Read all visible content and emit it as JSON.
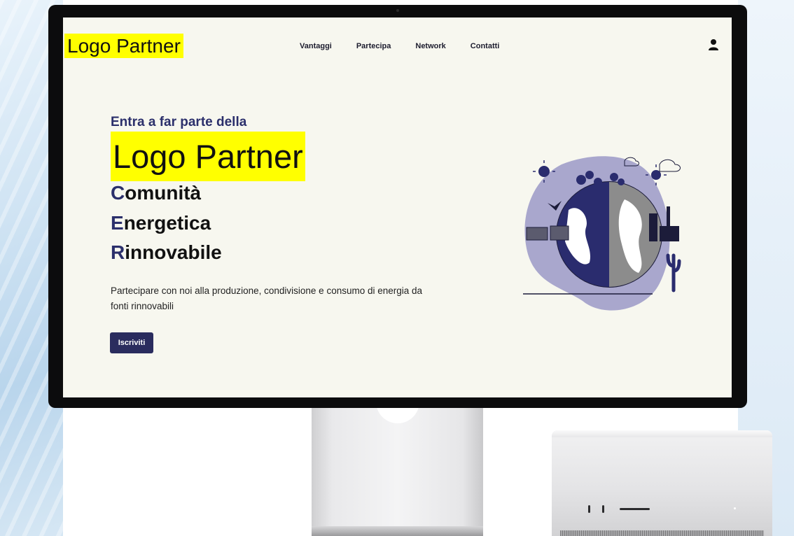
{
  "nav": {
    "logo": "Logo Partner",
    "items": [
      {
        "label": "Vantaggi"
      },
      {
        "label": "Partecipa"
      },
      {
        "label": "Network"
      },
      {
        "label": "Contatti"
      }
    ]
  },
  "hero": {
    "pre_title": "Entra a far parte della",
    "logo": "Logo Partner",
    "line_comunita_cap": "C",
    "line_comunita_rest": "omunità",
    "line_energetica_cap": "E",
    "line_energetica_rest": "nergetica",
    "line_rinnovabile_cap": "R",
    "line_rinnovabile_rest": "innovabile",
    "description": "Partecipare con noi alla produzione, condivisione e consumo di energia da fonti rinnovabili",
    "cta_label": "Iscriviti"
  },
  "icons": {
    "user": "user-icon",
    "illustration": "earth-renewable-illustration"
  },
  "colors": {
    "brand_navy": "#2a2c5e",
    "highlight_yellow": "#ffff00",
    "screen_bg": "#f7f7ef",
    "illustration_lavender": "#a9a7cd"
  }
}
